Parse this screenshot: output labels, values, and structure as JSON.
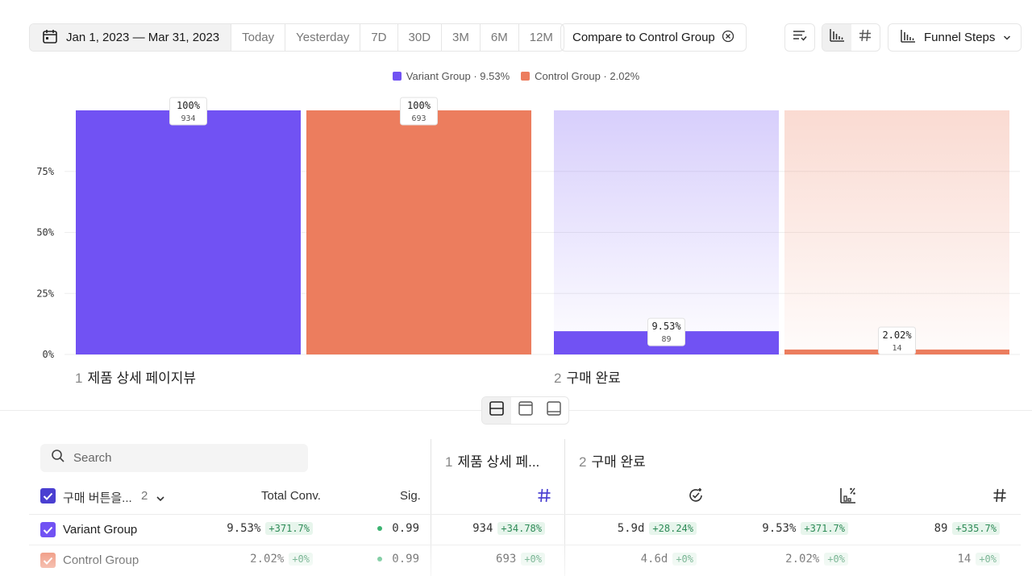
{
  "toolbar": {
    "date_range": "Jan 1, 2023 — Mar 31, 2023",
    "presets": [
      "Today",
      "Yesterday",
      "7D",
      "30D",
      "3M",
      "6M",
      "12M"
    ],
    "compare_label": "Compare to Control Group",
    "funnel_label": "Funnel Steps"
  },
  "legend": [
    {
      "label": "Variant Group · 9.53%",
      "color": "#7152f3"
    },
    {
      "label": "Control Group · 2.02%",
      "color": "#ec7d5e"
    }
  ],
  "chart_data": {
    "type": "bar",
    "categories": [
      "1 제품 상세 페이지뷰",
      "2 구매 완료"
    ],
    "step_labels": [
      {
        "num": "1",
        "name": "제품 상세 페이지뷰"
      },
      {
        "num": "2",
        "name": "구매 완료"
      }
    ],
    "series": [
      {
        "name": "Variant Group",
        "color": "#7152f3",
        "values": [
          100,
          9.53
        ],
        "labels": [
          "100%",
          "9.53%"
        ],
        "counts": [
          "934",
          "89"
        ]
      },
      {
        "name": "Control Group",
        "color": "#ec7d5e",
        "values": [
          100,
          2.02
        ],
        "labels": [
          "100%",
          "2.02%"
        ],
        "counts": [
          "693",
          "14"
        ]
      }
    ],
    "ylim": [
      0,
      100
    ],
    "yticks": [
      "0%",
      "25%",
      "50%",
      "75%"
    ],
    "grid": true,
    "legend_position": "top-center"
  },
  "table": {
    "search_placeholder": "Search",
    "group_label": "구매 버튼을...",
    "group_count": "2",
    "col_total_conv": "Total Conv.",
    "col_sig": "Sig.",
    "step1_header": {
      "num": "1",
      "name": "제품 상세 페..."
    },
    "step2_header": {
      "num": "2",
      "name": "구매 완료"
    },
    "rows": [
      {
        "name": "Variant Group",
        "color": "#7152f3",
        "total_conv": "9.53%",
        "total_conv_delta": "+371.7%",
        "sig": "0.99",
        "s1_count": "934",
        "s1_delta": "+34.78%",
        "s2_time": "5.9d",
        "s2_time_delta": "+28.24%",
        "s2_conv": "9.53%",
        "s2_conv_delta": "+371.7%",
        "s2_count": "89",
        "s2_count_delta": "+535.7%"
      },
      {
        "name": "Control Group",
        "color": "#ec7d5e",
        "total_conv": "2.02%",
        "total_conv_delta": "+0%",
        "sig": "0.99",
        "s1_count": "693",
        "s1_delta": "+0%",
        "s2_time": "4.6d",
        "s2_time_delta": "+0%",
        "s2_conv": "2.02%",
        "s2_conv_delta": "+0%",
        "s2_count": "14",
        "s2_count_delta": "+0%"
      }
    ]
  }
}
